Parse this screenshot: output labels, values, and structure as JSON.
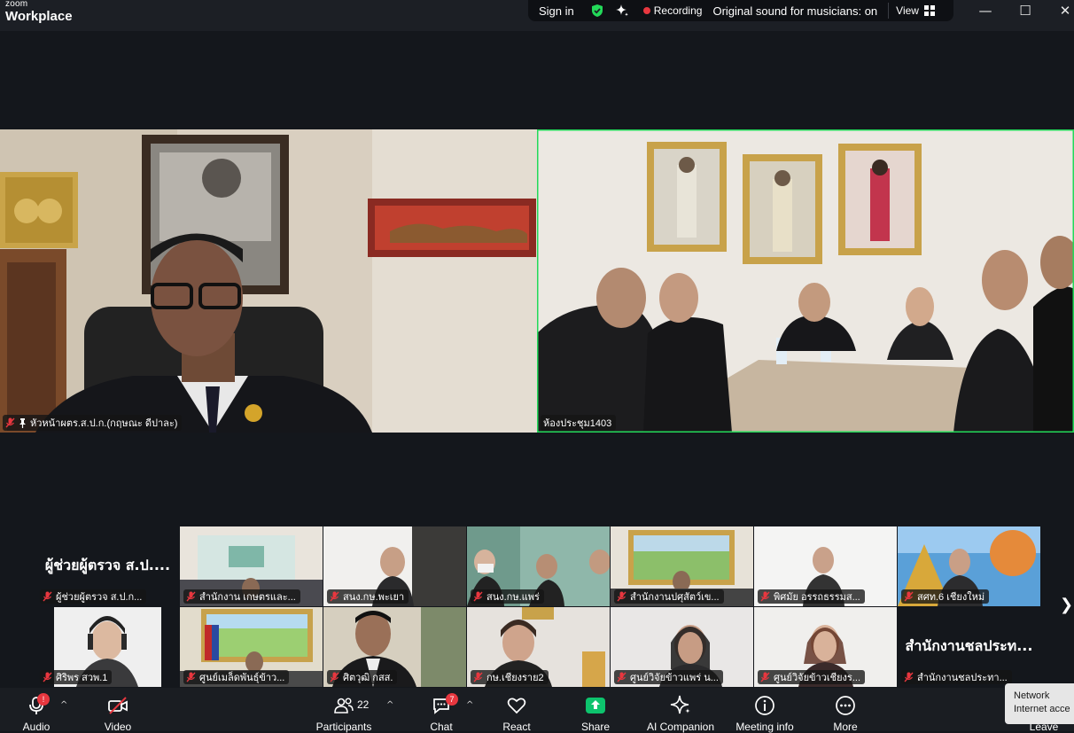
{
  "app": {
    "logo_small": "zoom",
    "logo_large": "Workplace"
  },
  "statusbar": {
    "sign_in": "Sign in",
    "recording": "Recording",
    "original_sound": "Original sound for musicians: on",
    "view": "View"
  },
  "window_controls": {
    "minimize": "—",
    "maximize": "☐",
    "close": "✕"
  },
  "main_tiles": [
    {
      "name": "หัวหน้าผตร.ส.ป.ก.(กฤษณะ ดีปาละ)",
      "muted": true,
      "pinned": true
    },
    {
      "name": "ห้องประชุม1403",
      "muted": false,
      "active_speaker": true
    }
  ],
  "thumbnails_row1": [
    {
      "name": "ผู้ช่วยผู้ตรวจ ส.ป.ก...",
      "big_name": "ผู้ช่วยผู้ตรวจ ส.ป....",
      "video": false
    },
    {
      "name": "สำนักงาน เกษตรและ...",
      "video": true
    },
    {
      "name": "สนง.กษ.พะเยา",
      "video": true
    },
    {
      "name": "สนง.กษ.แพร่",
      "video": true
    },
    {
      "name": "สำนักงานปศุสัตว์เข...",
      "video": true
    },
    {
      "name": "พิศมัย อรรถธรรมส...",
      "video": true
    },
    {
      "name": "สศท.6 เชียงใหม่",
      "video": true
    }
  ],
  "thumbnails_row2": [
    {
      "name": "ศิริพร สวพ.1",
      "video": true
    },
    {
      "name": "ศูนย์เมล็ดพันธุ์ข้าว...",
      "video": true
    },
    {
      "name": "ศิตวุฒิ กสส.",
      "video": true
    },
    {
      "name": "กษ.เชียงราย2",
      "video": true
    },
    {
      "name": "ศูนย์วิจัยข้าวแพร่ น...",
      "video": true
    },
    {
      "name": "ศูนย์วิจัยข้าวเชียงร...",
      "video": true
    },
    {
      "name": "สำนักงานชลประทา...",
      "big_name": "สำนักงานชลประท...",
      "video": false
    }
  ],
  "toolbar": {
    "audio": {
      "label": "Audio",
      "badge": "!"
    },
    "video": {
      "label": "Video"
    },
    "participants": {
      "label": "Participants",
      "count": "22"
    },
    "chat": {
      "label": "Chat",
      "badge": "7"
    },
    "react": {
      "label": "React"
    },
    "share": {
      "label": "Share"
    },
    "ai_companion": {
      "label": "AI Companion"
    },
    "meeting_info": {
      "label": "Meeting info"
    },
    "more": {
      "label": "More"
    },
    "leave": {
      "label": "Leave"
    }
  },
  "network_popup": {
    "line1": "Network",
    "line2": "Internet acce"
  },
  "colors": {
    "accent_green": "#23d959",
    "share_green": "#0dc36d",
    "record_red": "#e8373f",
    "background": "#14171c"
  }
}
